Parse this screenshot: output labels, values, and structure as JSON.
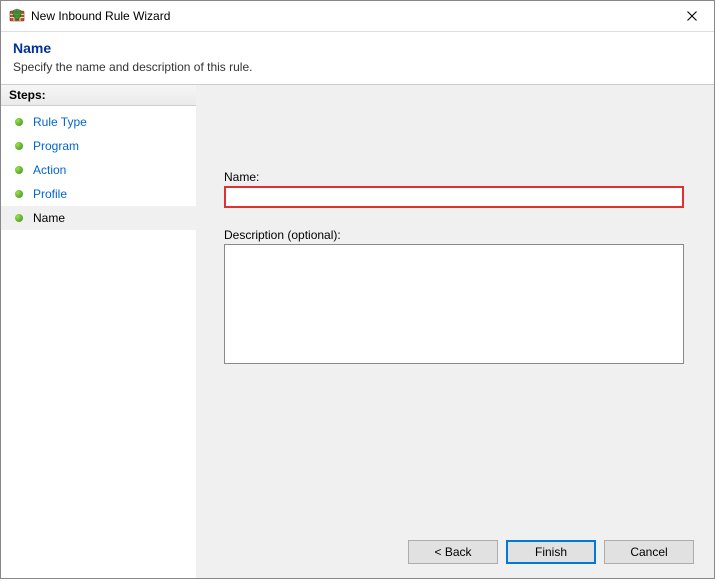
{
  "window": {
    "title": "New Inbound Rule Wizard"
  },
  "header": {
    "title": "Name",
    "subtitle": "Specify the name and description of this rule."
  },
  "sidebar": {
    "heading": "Steps:",
    "items": [
      {
        "label": "Rule Type",
        "link": true,
        "current": false
      },
      {
        "label": "Program",
        "link": true,
        "current": false
      },
      {
        "label": "Action",
        "link": true,
        "current": false
      },
      {
        "label": "Profile",
        "link": true,
        "current": false
      },
      {
        "label": "Name",
        "link": false,
        "current": true
      }
    ]
  },
  "form": {
    "name_label": "Name:",
    "name_value": "",
    "desc_label": "Description (optional):",
    "desc_value": ""
  },
  "buttons": {
    "back": "< Back",
    "finish": "Finish",
    "cancel": "Cancel"
  }
}
